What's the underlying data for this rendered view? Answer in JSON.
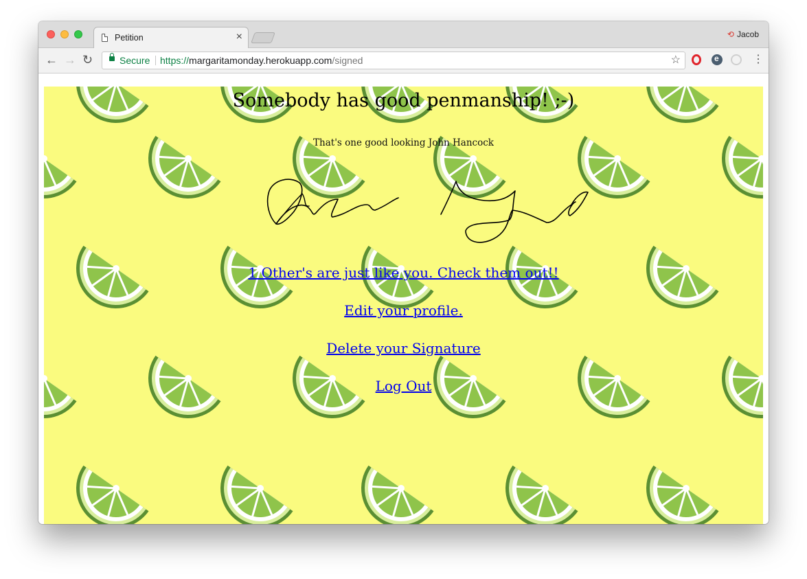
{
  "browser": {
    "tab_title": "Petition",
    "tab_close": "×",
    "profile_name": "Jacob",
    "security_label": "Secure",
    "url_scheme": "https://",
    "url_host": "margaritamonday.herokuapp.com",
    "url_path": "/signed",
    "icons": [
      "document-icon",
      "close-icon",
      "back-arrow-icon",
      "forward-arrow-icon",
      "reload-icon",
      "lock-icon",
      "star-icon",
      "opera-icon",
      "ghostery-icon",
      "extension-icon",
      "menu-icon",
      "profile-icon"
    ]
  },
  "page": {
    "heading": "Somebody has good penmanship! ;-)",
    "subtitle": "That's one good looking John Hancock",
    "links": {
      "others": "1 Other's are just like you. Check them out!!",
      "edit_profile": "Edit your profile.",
      "delete_signature": "Delete your Signature",
      "logout": "Log Out"
    }
  },
  "colors": {
    "page_background": "#fafb7f",
    "link": "#0000ee",
    "lime_dark": "#5b8f33",
    "lime_light": "#8fc44b",
    "secure_green": "#0b8043"
  }
}
